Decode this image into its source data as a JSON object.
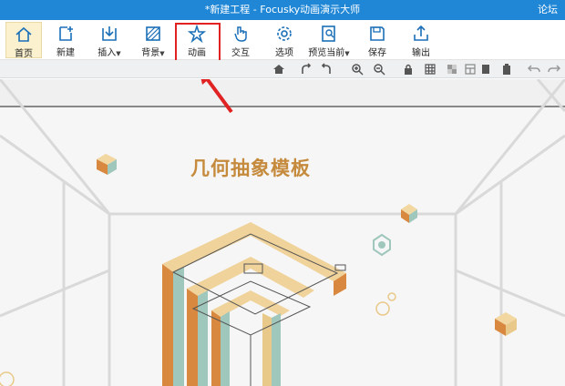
{
  "window": {
    "title": "*新建工程 - Focusky动画演示大师",
    "forum_link": "论坛"
  },
  "ribbon": {
    "items": [
      {
        "label": "首页",
        "icon": "home-icon",
        "active": true
      },
      {
        "label": "新建",
        "icon": "new-icon"
      },
      {
        "label": "插入",
        "icon": "insert-icon",
        "has_dropdown": true
      },
      {
        "label": "背景",
        "icon": "background-icon",
        "has_dropdown": true
      },
      {
        "label": "动画",
        "icon": "animation-star-icon",
        "highlighted": true
      },
      {
        "label": "交互",
        "icon": "interaction-hand-icon"
      },
      {
        "label": "选项",
        "icon": "gear-icon"
      },
      {
        "label": "预览当前",
        "icon": "preview-icon",
        "has_dropdown": true
      },
      {
        "label": "保存",
        "icon": "save-icon"
      },
      {
        "label": "输出",
        "icon": "export-icon"
      }
    ]
  },
  "canvas": {
    "title": "几何抽象模板"
  },
  "colors": {
    "titlebar": "#1f87d6",
    "accent_active": "#fbf1cf",
    "highlight_box": "#e02222",
    "template_title": "#c58a3c",
    "iso_gold": "#e8c98a",
    "iso_teal": "#9fc7bb",
    "iso_orange": "#d98a45"
  }
}
